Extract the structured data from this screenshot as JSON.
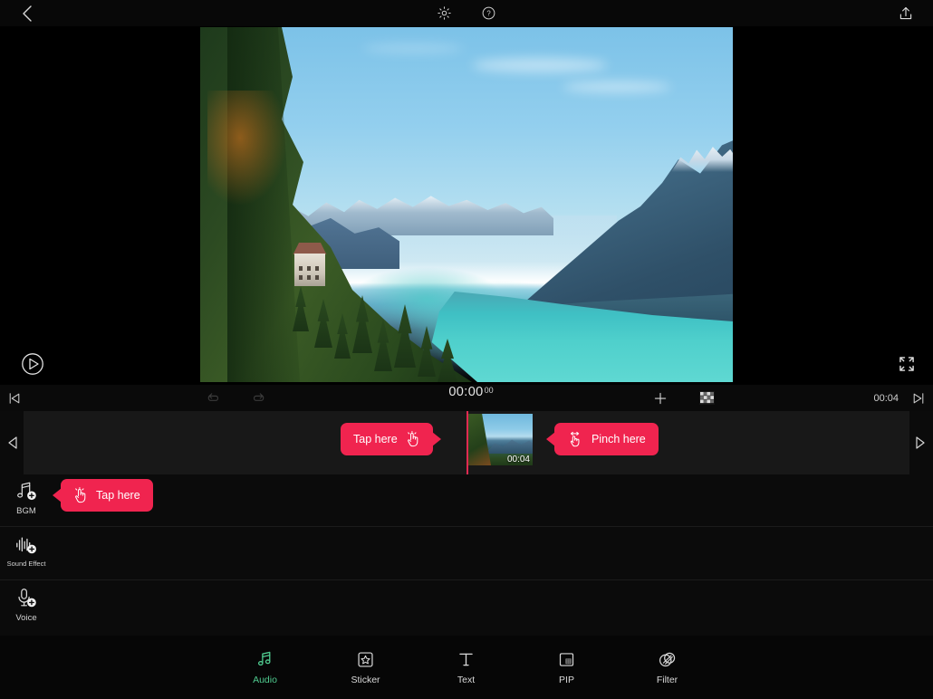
{
  "topbar": {
    "back_icon": "chevron-left-icon",
    "settings_icon": "gear-icon",
    "help_icon": "question-circle-icon",
    "export_icon": "upload-icon"
  },
  "preview": {
    "play_icon": "play-icon",
    "fullscreen_icon": "expand-icon",
    "scene_description": "Alpine lake with forested slope, chalet and snow-capped mountains"
  },
  "timeline_toolbar": {
    "skip_start_icon": "skip-to-start-icon",
    "undo_icon": "undo-icon",
    "redo_icon": "redo-icon",
    "current_time": "00:00",
    "current_frames": "00",
    "add_label": "+",
    "mosaic_icon": "transition-grid-icon",
    "total_time": "00:04",
    "skip_end_icon": "skip-to-end-icon"
  },
  "clip_track": {
    "prev_icon": "triangle-left-icon",
    "next_icon": "triangle-right-icon",
    "clip_duration": "00:04"
  },
  "tooltips": [
    {
      "id": "tap-clip",
      "label": "Tap here",
      "icon": "tap-hand-icon",
      "tail": "right"
    },
    {
      "id": "pinch",
      "label": "Pinch here",
      "icon": "pinch-gesture-icon",
      "tail": "left"
    },
    {
      "id": "tap-bgm",
      "label": "Tap here",
      "icon": "tap-hand-icon",
      "tail": "left"
    }
  ],
  "audio_tracks": [
    {
      "label": "BGM",
      "icon": "music-note-add-icon"
    },
    {
      "label": "Sound Effect",
      "icon": "waveform-add-icon"
    },
    {
      "label": "Voice",
      "icon": "microphone-add-icon"
    }
  ],
  "bottom_nav": {
    "active": "Audio",
    "items": [
      {
        "label": "Audio",
        "icon": "music-note-icon"
      },
      {
        "label": "Sticker",
        "icon": "star-square-icon"
      },
      {
        "label": "Text",
        "icon": "text-t-icon"
      },
      {
        "label": "PIP",
        "icon": "picture-in-picture-icon"
      },
      {
        "label": "Filter",
        "icon": "filter-circles-icon"
      }
    ]
  },
  "colors": {
    "accent_pink": "#f0244f",
    "accent_green": "#4fca8f",
    "playhead": "#e02a52",
    "background": "#000000"
  }
}
